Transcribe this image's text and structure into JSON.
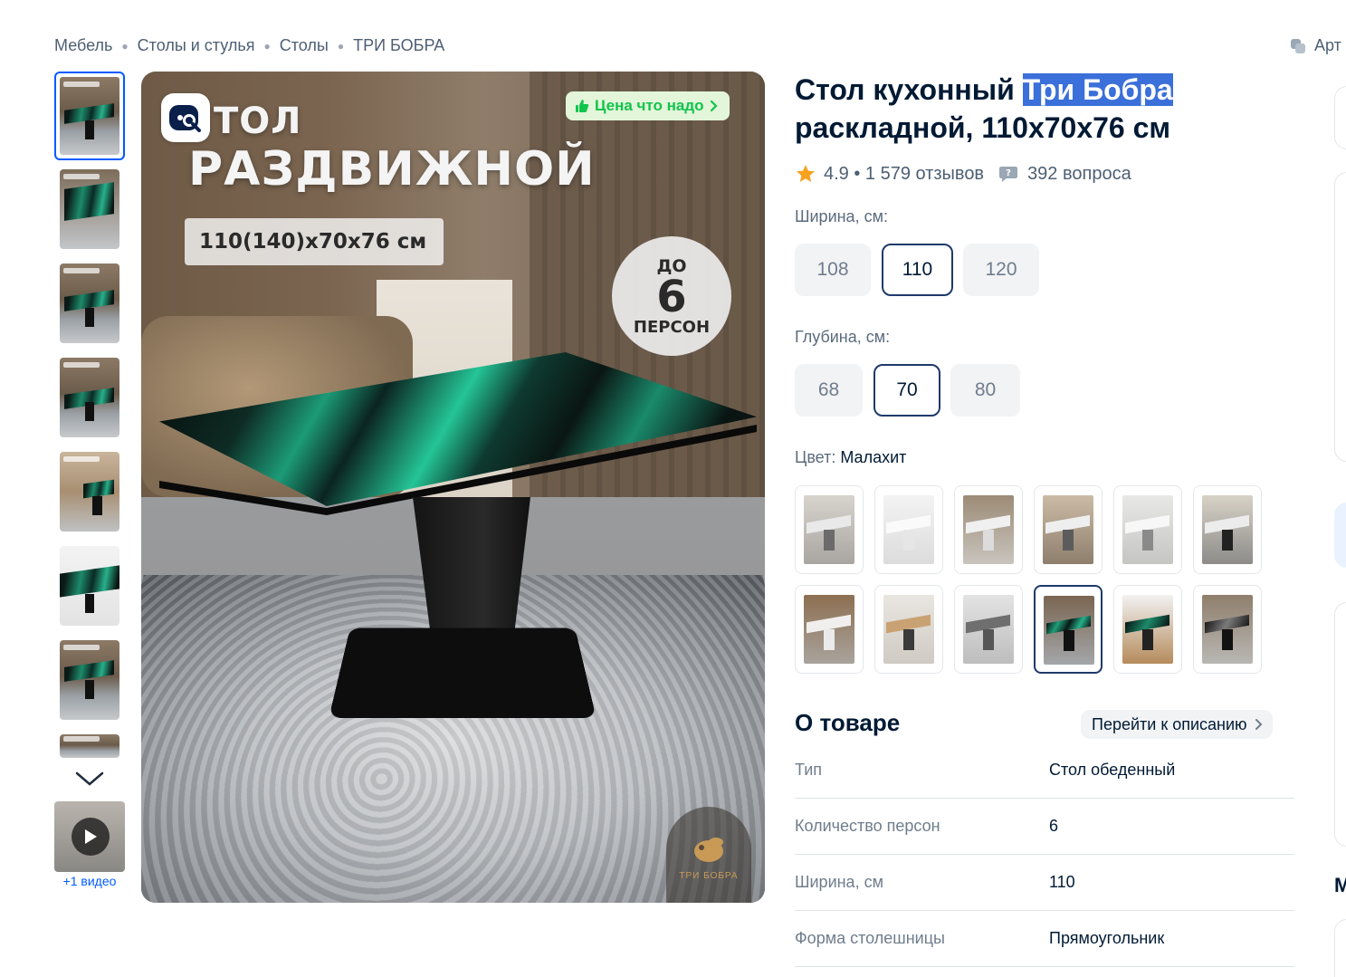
{
  "breadcrumb": [
    "Мебель",
    "Столы и стулья",
    "Столы",
    "ТРИ БОБРА"
  ],
  "article_label": "Арт",
  "gallery": {
    "thumbnail_count": 8,
    "video_label": "+1 видео"
  },
  "main_image": {
    "title_line1": "ТОЛ",
    "title_line2": "РАЗДВИЖНОЙ",
    "dimensions": "110(140)x70x76 см",
    "persons_top": "ДО",
    "persons_number": "6",
    "persons_bottom": "ПЕРСОН",
    "price_badge": "Цена что надо",
    "brand_logo_text": "ТРИ БОБРА"
  },
  "product": {
    "title_prefix": "Стол кухонный ",
    "title_brand": "Три Бобра",
    "title_suffix": " раскладной, 110x70x76 см",
    "rating": "4.9 • 1 579 отзывов",
    "questions": "392 вопроса"
  },
  "options": {
    "width_label": "Ширина, см:",
    "width_values": [
      "108",
      "110",
      "120"
    ],
    "width_selected": "110",
    "depth_label": "Глубина, см:",
    "depth_values": [
      "68",
      "70",
      "80"
    ],
    "depth_selected": "70",
    "color_label": "Цвет:",
    "color_value": "Малахит",
    "color_swatch_count": 12,
    "color_selected_index": 9
  },
  "about": {
    "title": "О товаре",
    "goto_label": "Перейти к описанию",
    "specs": [
      {
        "key": "Тип",
        "value": "Стол обеденный"
      },
      {
        "key": "Количество персон",
        "value": "6"
      },
      {
        "key": "Ширина, см",
        "value": "110"
      },
      {
        "key": "Форма столешницы",
        "value": "Прямоугольник"
      }
    ]
  },
  "side": {
    "partial_heading": "М"
  },
  "colors": {
    "accent": "#005bff",
    "selected_border": "#1f3a6b",
    "highlight": "#3b6fd9",
    "badge_green": "#10c44c",
    "star": "#f6a21e"
  }
}
